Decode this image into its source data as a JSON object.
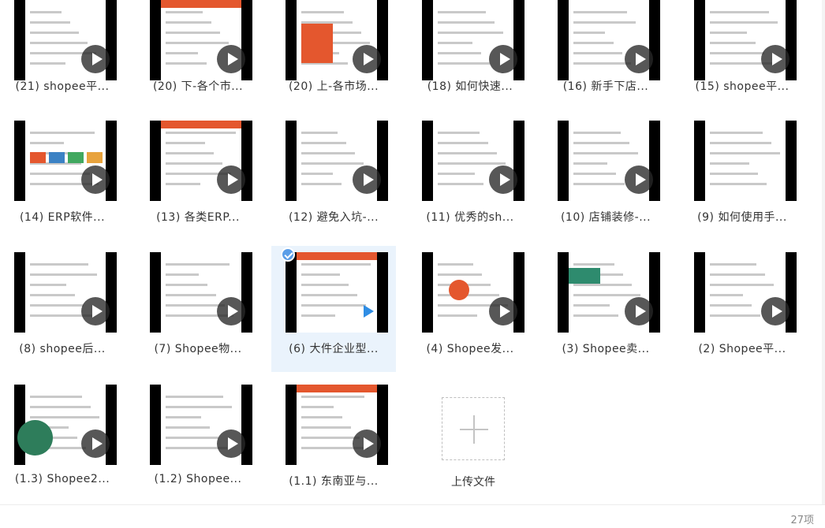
{
  "files": [
    {
      "label": "(21) shopee平...",
      "thumb": "web"
    },
    {
      "label": "(20) 下-各个市...",
      "thumb": "orange-table"
    },
    {
      "label": "(20) 上-各市场...",
      "thumb": "orange-left"
    },
    {
      "label": "(18) 如何快速...",
      "thumb": "shop"
    },
    {
      "label": "(16) 新手下店...",
      "thumb": "dialog"
    },
    {
      "label": "(15) shopee平...",
      "thumb": "text"
    },
    {
      "label": "(14) ERP软件...",
      "thumb": "desktop"
    },
    {
      "label": "(13) 各类ERP...",
      "thumb": "doc-red"
    },
    {
      "label": "(12) 避免入坑-...",
      "thumb": "list"
    },
    {
      "label": "(11) 优秀的sh...",
      "thumb": "dots"
    },
    {
      "label": "(10) 店铺装修-...",
      "thumb": "design"
    },
    {
      "label": "(9) 如何使用手...",
      "thumb": "mobile"
    },
    {
      "label": "(8) shopee后...",
      "thumb": "grid"
    },
    {
      "label": "(7) Shopee物...",
      "thumb": "formula"
    },
    {
      "label": "(6) 大件企业型...",
      "thumb": "flow",
      "selected": true
    },
    {
      "label": "(4) Shopee发...",
      "thumb": "part3"
    },
    {
      "label": "(3) Shopee卖...",
      "thumb": "green-web"
    },
    {
      "label": "(2) Shopee平...",
      "thumb": "outline"
    },
    {
      "label": "(1.3) Shopee2...",
      "thumb": "pie"
    },
    {
      "label": "(1.2) Shopee...",
      "thumb": "shoes"
    },
    {
      "label": "(1.1) 东南亚与...",
      "thumb": "red-slide"
    }
  ],
  "upload": {
    "label": "上传文件",
    "icon": "plus-icon"
  },
  "status": {
    "count": "27项"
  },
  "colors": {
    "accent": "#e4572e",
    "selected_bg": "#eaf3fc",
    "check": "#5b9ee8",
    "play_blue": "#2f8de4"
  }
}
